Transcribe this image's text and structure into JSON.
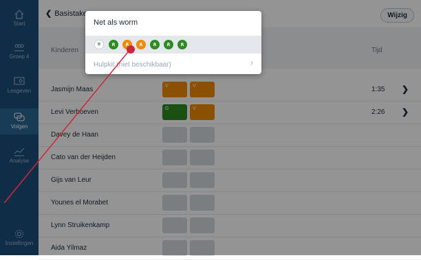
{
  "sidebar": {
    "items": [
      {
        "label": "Start",
        "icon": "home-icon"
      },
      {
        "label": "Groep 4",
        "icon": "group-icon"
      },
      {
        "label": "Lesgeven",
        "icon": "board-icon"
      },
      {
        "label": "Volgen",
        "icon": "chat-icon"
      },
      {
        "label": "Analyse",
        "icon": "chart-icon"
      },
      {
        "label": "Instellingen",
        "icon": "gear-icon"
      }
    ]
  },
  "topbar": {
    "back_label": "Basistaken",
    "edit_label": "Wijzig"
  },
  "table": {
    "col_children": "Kinderen",
    "col_time": "Tijd",
    "rows": [
      {
        "name": "Jasmijn Maas",
        "c1": "V",
        "c2": "V",
        "time": "1:35"
      },
      {
        "name": "Levi Verhoeven",
        "c1": "G",
        "c2": "V",
        "time": "2:26"
      },
      {
        "name": "Davey de Haan"
      },
      {
        "name": "Cato van der Heijden"
      },
      {
        "name": "Gijs van Leur"
      },
      {
        "name": "Younes el Morabet"
      },
      {
        "name": "Lynn Struikenkamp"
      },
      {
        "name": "Aida Yilmaz"
      }
    ]
  },
  "popup": {
    "title": "Net als worm",
    "hulpkit_label": "Hulpkit (niet beschikbaar)",
    "levels": [
      "=",
      "ጸ",
      "ጸ",
      "ጸ",
      "ጸ",
      "ጸ",
      "ጸ"
    ]
  },
  "colors": {
    "sidebar": "#1d4f7a",
    "orange": "#f08a00",
    "green": "#2e8b1f",
    "pointer": "#d0263b"
  }
}
